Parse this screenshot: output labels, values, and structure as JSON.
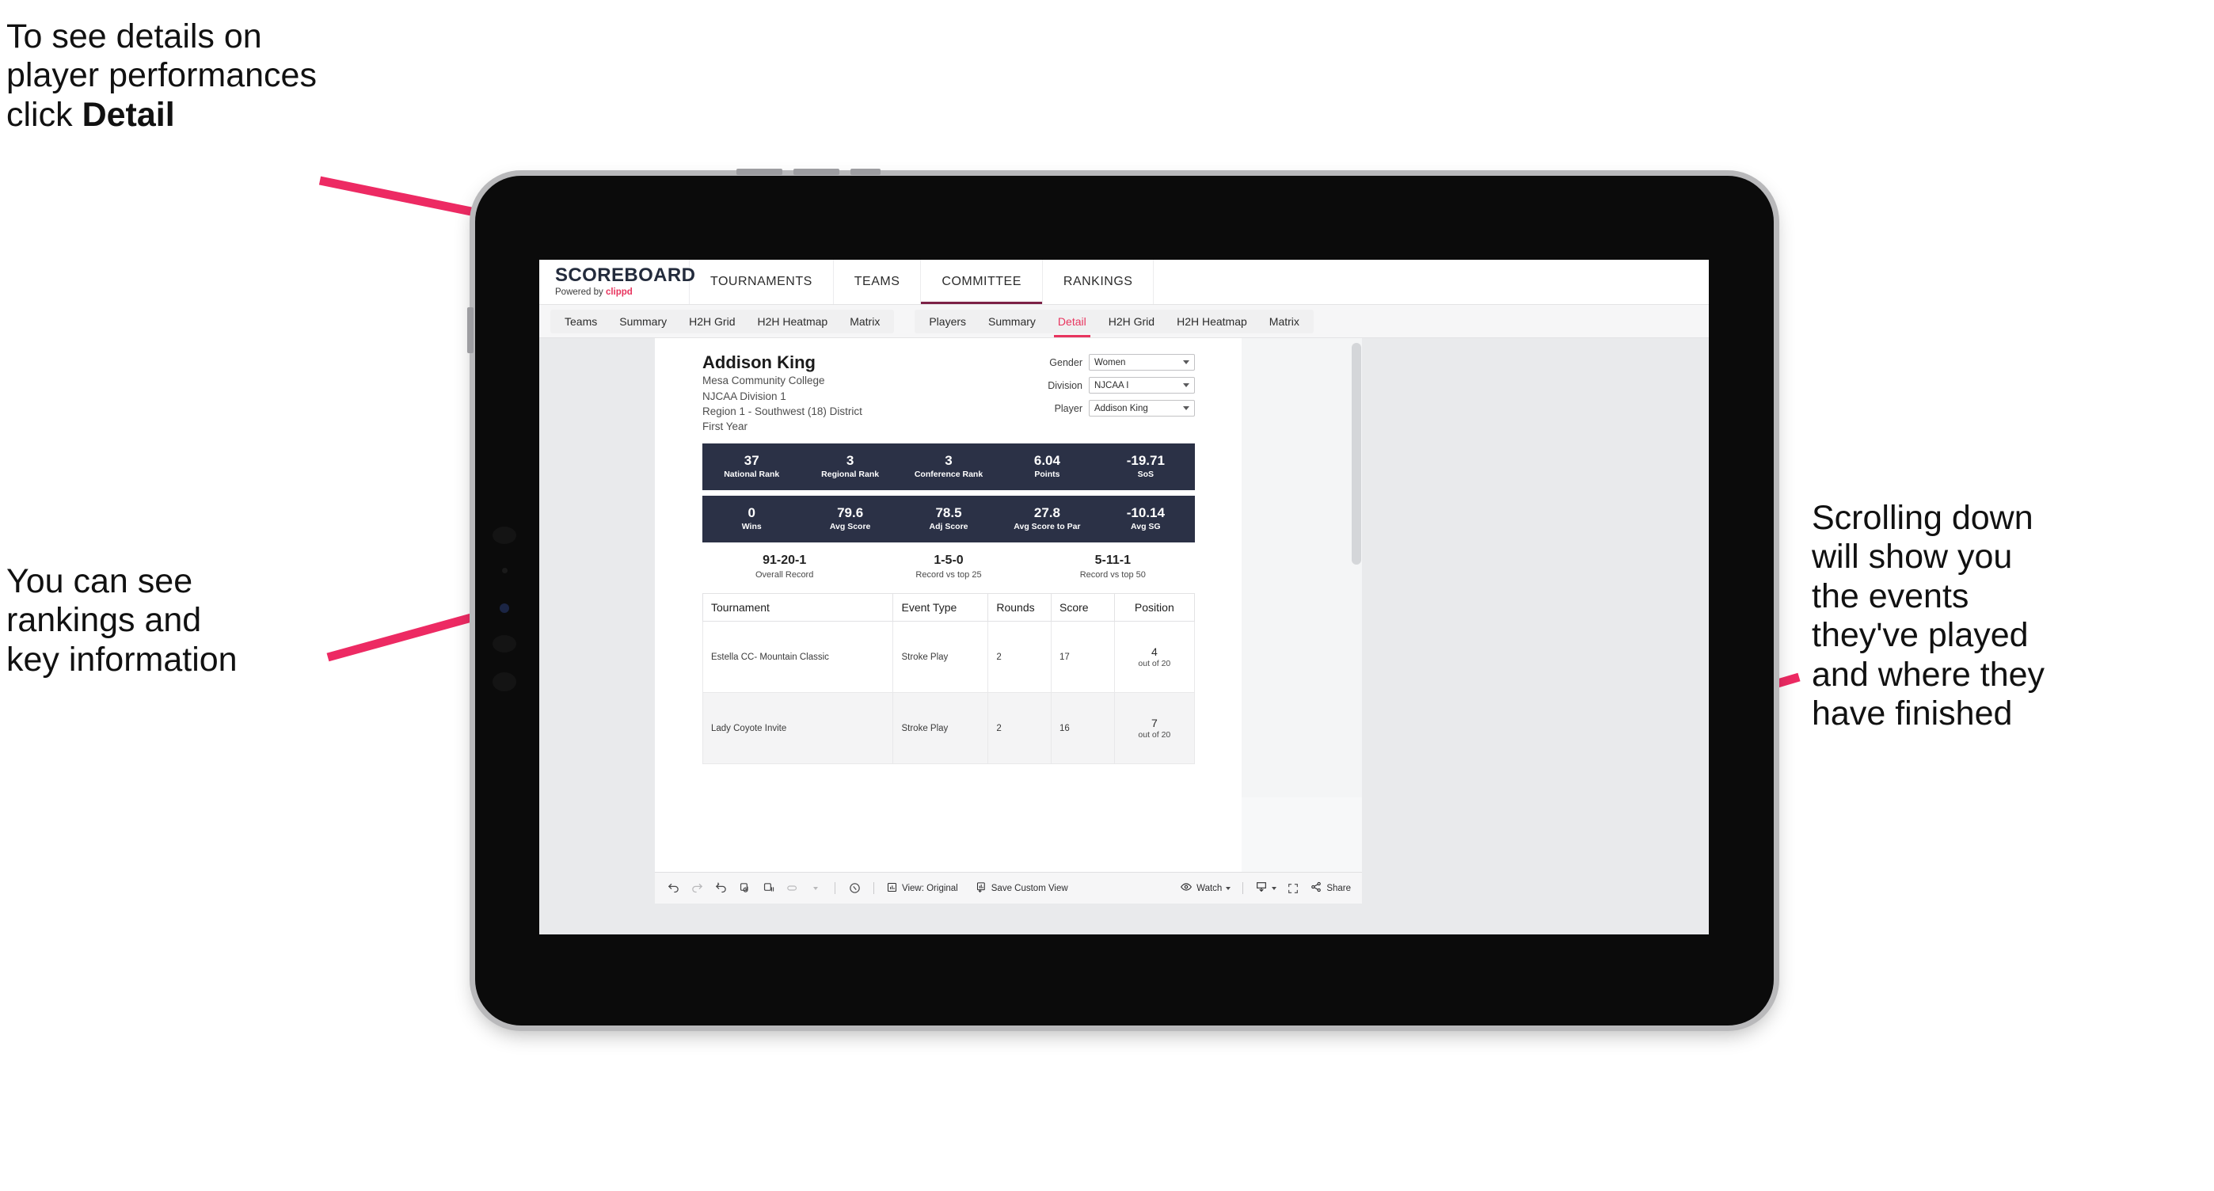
{
  "annotations": {
    "detail": "To see details on\nplayer performances\nclick ",
    "detail_bold": "Detail",
    "rankings": "You can see\nrankings and\nkey information",
    "scroll": "Scrolling down\nwill show you\nthe events\nthey've played\nand where they\nhave finished"
  },
  "colors": {
    "accent_pink": "#e8355f",
    "band_navy": "#2b3146",
    "active_underline": "#7d2348"
  },
  "app": {
    "brand": {
      "title": "SCOREBOARD",
      "powered_prefix": "Powered by ",
      "powered_brand": "clippd"
    },
    "top_nav": [
      {
        "label": "TOURNAMENTS",
        "active": false
      },
      {
        "label": "TEAMS",
        "active": false
      },
      {
        "label": "COMMITTEE",
        "active": true
      },
      {
        "label": "RANKINGS",
        "active": false
      }
    ],
    "sub_nav_groups": [
      {
        "name": "teams-group",
        "tabs": [
          {
            "label": "Teams",
            "active": false
          },
          {
            "label": "Summary",
            "active": false
          },
          {
            "label": "H2H Grid",
            "active": false
          },
          {
            "label": "H2H Heatmap",
            "active": false
          },
          {
            "label": "Matrix",
            "active": false
          }
        ]
      },
      {
        "name": "players-group",
        "tabs": [
          {
            "label": "Players",
            "active": false
          },
          {
            "label": "Summary",
            "active": false
          },
          {
            "label": "Detail",
            "active": true
          },
          {
            "label": "H2H Grid",
            "active": false
          },
          {
            "label": "H2H Heatmap",
            "active": false
          },
          {
            "label": "Matrix",
            "active": false
          }
        ]
      }
    ]
  },
  "report": {
    "player": {
      "name": "Addison King",
      "school": "Mesa Community College",
      "division": "NJCAA Division 1",
      "region": "Region 1 - Southwest (18) District",
      "year": "First Year"
    },
    "filters": [
      {
        "label": "Gender",
        "value": "Women"
      },
      {
        "label": "Division",
        "value": "NJCAA I"
      },
      {
        "label": "Player",
        "value": "Addison King"
      }
    ],
    "stat_band_1": [
      {
        "value": "37",
        "label": "National Rank"
      },
      {
        "value": "3",
        "label": "Regional Rank"
      },
      {
        "value": "3",
        "label": "Conference Rank"
      },
      {
        "value": "6.04",
        "label": "Points"
      },
      {
        "value": "-19.71",
        "label": "SoS"
      }
    ],
    "stat_band_2": [
      {
        "value": "0",
        "label": "Wins"
      },
      {
        "value": "79.6",
        "label": "Avg Score"
      },
      {
        "value": "78.5",
        "label": "Adj Score"
      },
      {
        "value": "27.8",
        "label": "Avg Score to Par"
      },
      {
        "value": "-10.14",
        "label": "Avg SG"
      }
    ],
    "records": [
      {
        "value": "91-20-1",
        "label": "Overall Record"
      },
      {
        "value": "1-5-0",
        "label": "Record vs top 25"
      },
      {
        "value": "5-11-1",
        "label": "Record vs top 50"
      }
    ],
    "table": {
      "headers": [
        "Tournament",
        "Event Type",
        "Rounds",
        "Score",
        "Position"
      ],
      "rows": [
        {
          "tournament": "Estella CC- Mountain Classic",
          "event_type": "Stroke Play",
          "rounds": "2",
          "score": "17",
          "position": "4",
          "position_of": "out of 20"
        },
        {
          "tournament": "Lady Coyote Invite",
          "event_type": "Stroke Play",
          "rounds": "2",
          "score": "16",
          "position": "7",
          "position_of": "out of 20"
        }
      ]
    }
  },
  "toolbar": {
    "view_label": "View: Original",
    "save_label": "Save Custom View",
    "watch_label": "Watch",
    "share_label": "Share"
  }
}
